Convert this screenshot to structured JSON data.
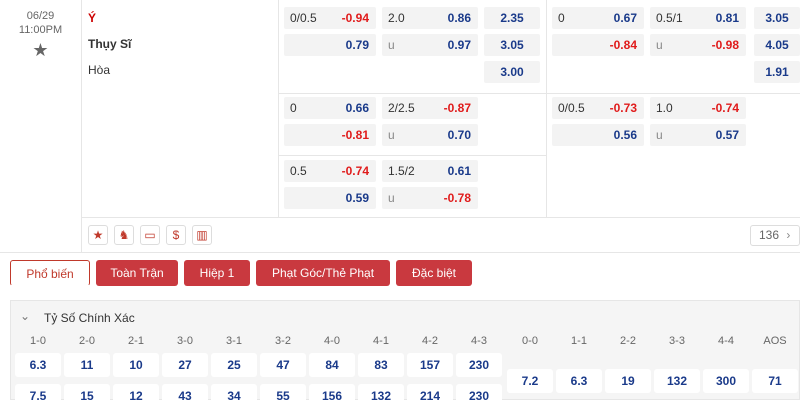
{
  "match": {
    "date": "06/29",
    "time": "11:00PM",
    "home": "Ý",
    "away": "Thụy Sĩ",
    "draw": "Hòa"
  },
  "odds": {
    "ft_block1": [
      {
        "l": "0/0.5",
        "v": "-0.94",
        "c": "neg"
      },
      {
        "l": "2.0",
        "v": "0.86",
        "c": "pos"
      },
      {
        "v": "2.35"
      },
      {
        "l": "",
        "v": "0.79",
        "c": "pos"
      },
      {
        "l": "u",
        "v": "0.97",
        "c": "pos"
      },
      {
        "v": "3.05"
      },
      {
        "v": "3.00"
      }
    ],
    "ht_block1": [
      {
        "l": "0",
        "v": "0.67",
        "c": "pos"
      },
      {
        "l": "0.5/1",
        "v": "0.81",
        "c": "pos"
      },
      {
        "v": "3.05"
      },
      {
        "l": "",
        "v": "-0.84",
        "c": "neg"
      },
      {
        "l": "u",
        "v": "-0.98",
        "c": "neg"
      },
      {
        "v": "4.05"
      },
      {
        "v": "1.91"
      }
    ],
    "ft_block2": [
      {
        "l": "0",
        "v": "0.66",
        "c": "pos"
      },
      {
        "l": "2/2.5",
        "v": "-0.87",
        "c": "neg"
      },
      {
        "l": "",
        "v": "-0.81",
        "c": "neg"
      },
      {
        "l": "u",
        "v": "0.70",
        "c": "pos"
      }
    ],
    "ht_block2": [
      {
        "l": "0/0.5",
        "v": "-0.73",
        "c": "neg"
      },
      {
        "l": "1.0",
        "v": "-0.74",
        "c": "neg"
      },
      {
        "l": "",
        "v": "0.56",
        "c": "pos"
      },
      {
        "l": "u",
        "v": "0.57",
        "c": "pos"
      }
    ],
    "ft_block3": [
      {
        "l": "0.5",
        "v": "-0.74",
        "c": "neg"
      },
      {
        "l": "1.5/2",
        "v": "0.61",
        "c": "pos"
      },
      {
        "l": "",
        "v": "0.59",
        "c": "pos"
      },
      {
        "l": "u",
        "v": "-0.78",
        "c": "neg"
      }
    ]
  },
  "icons": [
    "star-icon",
    "lion-icon",
    "card-icon",
    "dollar-icon",
    "stats-icon"
  ],
  "more_count": "136",
  "tabs": [
    "Phổ biến",
    "Toàn Trận",
    "Hiệp 1",
    "Phạt Góc/Thẻ Phạt",
    "Đặc biệt"
  ],
  "section_title": "Tỷ Số Chính Xác",
  "scores": {
    "headers_left": [
      "1-0",
      "2-0",
      "2-1",
      "3-0",
      "3-1",
      "3-2",
      "4-0",
      "4-1",
      "4-2",
      "4-3"
    ],
    "headers_right": [
      "0-0",
      "1-1",
      "2-2",
      "3-3",
      "4-4",
      "AOS"
    ],
    "row1": [
      "6.3",
      "11",
      "10",
      "27",
      "25",
      "47",
      "84",
      "83",
      "157",
      "230"
    ],
    "row2": [
      "7.5",
      "15",
      "12",
      "43",
      "34",
      "55",
      "156",
      "132",
      "214",
      "230"
    ],
    "right_vals": [
      "7.2",
      "6.3",
      "19",
      "132",
      "300",
      "71"
    ]
  },
  "colors": {
    "accent": "#c9393f",
    "pos": "#1a3a8a",
    "neg": "#e01b1b"
  }
}
